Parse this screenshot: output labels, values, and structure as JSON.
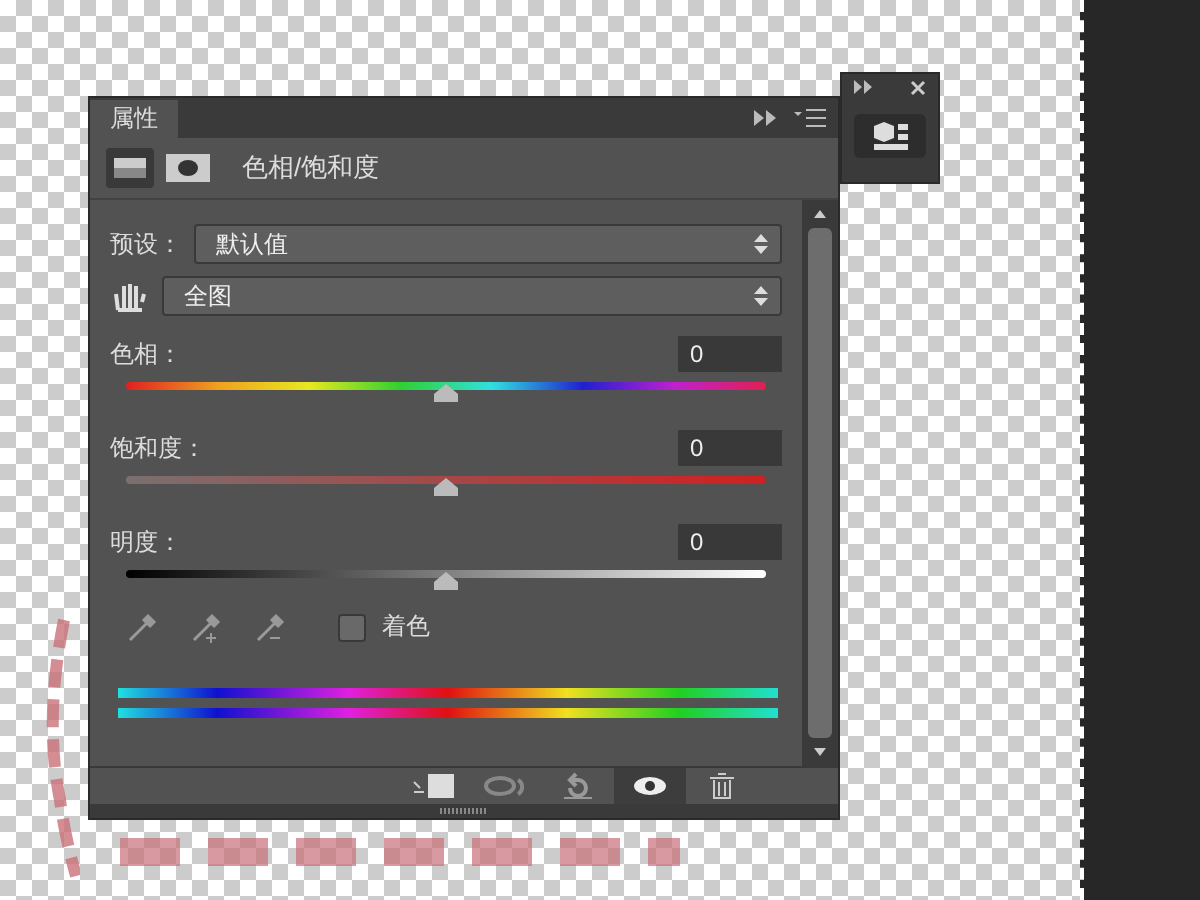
{
  "panel_tab": {
    "label": "属性",
    "selected": true
  },
  "adjustment": {
    "title": "色相/饱和度"
  },
  "preset": {
    "label": "预设：",
    "value": "默认值"
  },
  "range": {
    "value": "全图"
  },
  "sliders": [
    {
      "kind": "hue",
      "label": "色相：",
      "value": "0",
      "level": 0.5
    },
    {
      "kind": "saturation",
      "label": "饱和度：",
      "value": "0",
      "level": 0.5
    },
    {
      "kind": "lightness",
      "label": "明度：",
      "value": "0",
      "level": 0.5
    }
  ],
  "colorize": {
    "label": "着色",
    "checked": false
  },
  "visibility": {
    "on": true
  }
}
